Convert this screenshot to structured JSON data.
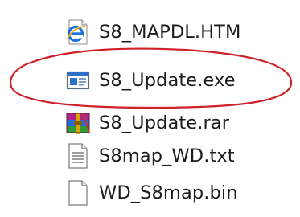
{
  "files": [
    {
      "name": "S8_MAPDL.HTM",
      "icon": "html-document-icon"
    },
    {
      "name": "S8_Update.exe",
      "icon": "application-exe-icon"
    },
    {
      "name": "S8_Update.rar",
      "icon": "rar-archive-icon"
    },
    {
      "name": "S8map_WD.txt",
      "icon": "text-document-icon"
    },
    {
      "name": "WD_S8map.bin",
      "icon": "blank-file-icon"
    }
  ],
  "colors": {
    "highlight": "#d0202a",
    "text": "#1c1c1c",
    "ie_blue": "#1e6fd9",
    "exe_blue": "#2f6fca"
  }
}
